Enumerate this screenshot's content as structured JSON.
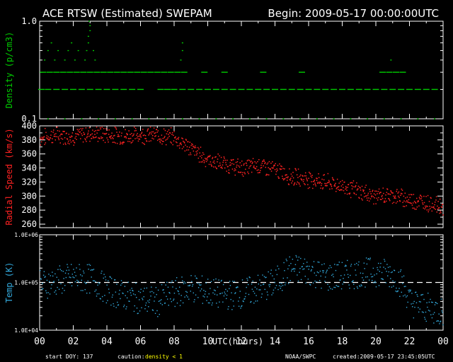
{
  "header": {
    "title": "ACE RTSW (Estimated) SWEPAM",
    "begin": "Begin: 2009-05-17 00:00:00UTC"
  },
  "footer": {
    "start_doy": "start DOY: 137",
    "caution_prefix": "caution:",
    "caution_text": "density < 1",
    "source": "NOAA/SWPC",
    "created": "created:2009-05-17 23:45:05UTC"
  },
  "colors": {
    "background": "#000000",
    "axes": "#ffffff",
    "density": "#00cc00",
    "speed": "#ff2222",
    "temp": "#33aadd",
    "caution": "#ffff00"
  },
  "chart_data": [
    {
      "type": "scatter",
      "title": "ACE RTSW (Estimated) SWEPAM",
      "ylabel": "Density (p/cm3)",
      "yscale": "log",
      "ylim": [
        0.1,
        1.0
      ],
      "ytick_labels": [
        "1.0",
        "0.1"
      ],
      "xlim": [
        0,
        24
      ],
      "series": [
        {
          "color": "#00cc00",
          "points": [
            [
              0.1,
              0.2
            ],
            [
              0.5,
              0.2
            ],
            [
              1.0,
              0.2
            ],
            [
              1.5,
              0.2
            ],
            [
              2.0,
              0.2
            ],
            [
              2.5,
              0.2
            ],
            [
              3.0,
              0.2
            ],
            [
              3.5,
              0.2
            ],
            [
              4.0,
              0.2
            ],
            [
              4.5,
              0.2
            ],
            [
              5.0,
              0.2
            ],
            [
              5.5,
              0.2
            ],
            [
              6.0,
              0.2
            ],
            [
              7.2,
              0.2
            ],
            [
              7.6,
              0.2
            ],
            [
              8.0,
              0.2
            ],
            [
              8.5,
              0.2
            ],
            [
              9.0,
              0.2
            ],
            [
              9.5,
              0.2
            ],
            [
              10.0,
              0.2
            ],
            [
              10.5,
              0.2
            ],
            [
              11.0,
              0.2
            ],
            [
              11.5,
              0.2
            ],
            [
              12.0,
              0.2
            ],
            [
              12.5,
              0.2
            ],
            [
              13.0,
              0.2
            ],
            [
              13.5,
              0.2
            ],
            [
              14.0,
              0.2
            ],
            [
              14.5,
              0.2
            ],
            [
              15.0,
              0.2
            ],
            [
              15.5,
              0.2
            ],
            [
              16.0,
              0.2
            ],
            [
              16.5,
              0.2
            ],
            [
              17.0,
              0.2
            ],
            [
              17.5,
              0.2
            ],
            [
              18.0,
              0.2
            ],
            [
              18.5,
              0.2
            ],
            [
              19.0,
              0.2
            ],
            [
              19.5,
              0.2
            ],
            [
              20.0,
              0.2
            ],
            [
              20.5,
              0.2
            ],
            [
              21.0,
              0.2
            ],
            [
              21.5,
              0.2
            ],
            [
              22.0,
              0.2
            ],
            [
              22.5,
              0.2
            ],
            [
              23.0,
              0.2
            ],
            [
              23.5,
              0.2
            ],
            [
              0.2,
              0.3
            ],
            [
              0.6,
              0.3
            ],
            [
              1.0,
              0.3
            ],
            [
              1.4,
              0.3
            ],
            [
              1.8,
              0.3
            ],
            [
              2.2,
              0.3
            ],
            [
              2.6,
              0.3
            ],
            [
              3.0,
              0.3
            ],
            [
              3.4,
              0.3
            ],
            [
              3.8,
              0.3
            ],
            [
              4.2,
              0.3
            ],
            [
              4.6,
              0.3
            ],
            [
              5.0,
              0.3
            ],
            [
              5.4,
              0.3
            ],
            [
              5.8,
              0.3
            ],
            [
              6.2,
              0.3
            ],
            [
              6.6,
              0.3
            ],
            [
              7.0,
              0.3
            ],
            [
              7.4,
              0.3
            ],
            [
              7.8,
              0.3
            ],
            [
              8.2,
              0.3
            ],
            [
              8.6,
              0.3
            ],
            [
              9.8,
              0.3
            ],
            [
              11.0,
              0.3
            ],
            [
              13.3,
              0.3
            ],
            [
              15.6,
              0.3
            ],
            [
              20.4,
              0.3
            ],
            [
              20.8,
              0.3
            ],
            [
              21.2,
              0.3
            ],
            [
              21.6,
              0.3
            ],
            [
              0.3,
              0.4
            ],
            [
              0.9,
              0.4
            ],
            [
              1.5,
              0.4
            ],
            [
              2.1,
              0.4
            ],
            [
              2.7,
              0.4
            ],
            [
              3.3,
              0.4
            ],
            [
              8.4,
              0.4
            ],
            [
              20.9,
              0.4
            ],
            [
              0.5,
              0.5
            ],
            [
              1.1,
              0.5
            ],
            [
              1.7,
              0.5
            ],
            [
              2.3,
              0.5
            ],
            [
              2.8,
              0.5
            ],
            [
              3.2,
              0.5
            ],
            [
              8.5,
              0.5
            ],
            [
              0.7,
              0.6
            ],
            [
              1.9,
              0.6
            ],
            [
              2.9,
              0.6
            ],
            [
              8.5,
              0.6
            ],
            [
              2.9,
              0.7
            ],
            [
              3.0,
              0.8
            ],
            [
              3.0,
              0.9
            ],
            [
              2.95,
              1.0
            ],
            [
              0.5,
              0.1
            ],
            [
              1.5,
              0.1
            ],
            [
              2.5,
              0.1
            ],
            [
              3.5,
              0.1
            ],
            [
              4.5,
              0.1
            ],
            [
              5.5,
              0.1
            ],
            [
              6.5,
              0.1
            ],
            [
              7.5,
              0.1
            ],
            [
              8.5,
              0.1
            ],
            [
              9.5,
              0.1
            ],
            [
              10.5,
              0.1
            ],
            [
              11.5,
              0.1
            ],
            [
              12.5,
              0.1
            ],
            [
              13.5,
              0.1
            ],
            [
              14.5,
              0.1
            ],
            [
              15.5,
              0.1
            ],
            [
              16.5,
              0.1
            ],
            [
              17.5,
              0.1
            ],
            [
              18.5,
              0.1
            ],
            [
              19.5,
              0.1
            ],
            [
              20.5,
              0.1
            ],
            [
              21.5,
              0.1
            ],
            [
              22.5,
              0.1
            ],
            [
              23.5,
              0.1
            ]
          ]
        }
      ]
    },
    {
      "type": "scatter",
      "ylabel": "Radial Speed (km/s)",
      "ylim": [
        255,
        400
      ],
      "ytick_labels": [
        "400",
        "380",
        "360",
        "340",
        "320",
        "300",
        "280",
        "260"
      ],
      "xlim": [
        0,
        24
      ],
      "series": [
        {
          "color": "#ff2222",
          "trend": [
            [
              0,
              383
            ],
            [
              1,
              388
            ],
            [
              2,
              385
            ],
            [
              3,
              390
            ],
            [
              4,
              388
            ],
            [
              5,
              386
            ],
            [
              6,
              388
            ],
            [
              7,
              387
            ],
            [
              8,
              384
            ],
            [
              9,
              368
            ],
            [
              10,
              352
            ],
            [
              11,
              346
            ],
            [
              12,
              340
            ],
            [
              13,
              345
            ],
            [
              14,
              338
            ],
            [
              15,
              328
            ],
            [
              16,
              325
            ],
            [
              17,
              320
            ],
            [
              18,
              315
            ],
            [
              19,
              307
            ],
            [
              20,
              300
            ],
            [
              21,
              302
            ],
            [
              22,
              295
            ],
            [
              23,
              292
            ],
            [
              24,
              285
            ]
          ],
          "spread": 10
        }
      ]
    },
    {
      "type": "scatter",
      "ylabel": "Temp (K)",
      "yscale": "log",
      "ylim": [
        10000,
        1000000
      ],
      "ytick_labels": [
        "1.0E+06",
        "1.0E+05",
        "1.0E+04"
      ],
      "reference_line": 100000,
      "xlim": [
        0,
        24
      ],
      "xlabel": "UTC(hours)",
      "xtick_labels": [
        "00",
        "02",
        "04",
        "06",
        "08",
        "10",
        "12",
        "14",
        "16",
        "18",
        "20",
        "22",
        "00"
      ],
      "series": [
        {
          "color": "#33aadd",
          "trend": [
            [
              0,
              90000
            ],
            [
              1,
              110000
            ],
            [
              2,
              130000
            ],
            [
              3,
              120000
            ],
            [
              4,
              70000
            ],
            [
              5,
              55000
            ],
            [
              6,
              45000
            ],
            [
              7,
              40000
            ],
            [
              8,
              60000
            ],
            [
              9,
              80000
            ],
            [
              10,
              65000
            ],
            [
              11,
              55000
            ],
            [
              12,
              60000
            ],
            [
              13,
              75000
            ],
            [
              14,
              100000
            ],
            [
              15,
              200000
            ],
            [
              16,
              180000
            ],
            [
              17,
              130000
            ],
            [
              18,
              140000
            ],
            [
              19,
              160000
            ],
            [
              20,
              170000
            ],
            [
              21,
              150000
            ],
            [
              22,
              40000
            ],
            [
              23,
              30000
            ],
            [
              24,
              25000
            ]
          ],
          "spread_log": 0.45
        }
      ]
    }
  ]
}
